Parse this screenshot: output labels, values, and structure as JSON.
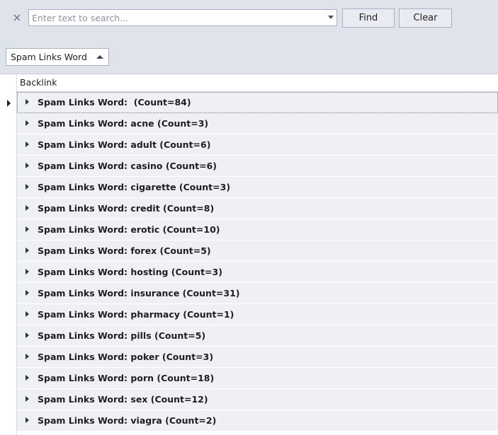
{
  "search": {
    "clear_icon": "×",
    "placeholder": "Enter text to search...",
    "value": "",
    "find_label": "Find",
    "clear_label": "Clear"
  },
  "group_panel": {
    "group_column": "Spam Links Word",
    "sort": "ascending"
  },
  "grid": {
    "column_header": "Backlink",
    "focused_row": 0,
    "group_rows": [
      "Spam Links Word:  (Count=84)",
      "Spam Links Word: acne (Count=3)",
      "Spam Links Word: adult (Count=6)",
      "Spam Links Word: casino (Count=6)",
      "Spam Links Word: cigarette (Count=3)",
      "Spam Links Word: credit (Count=8)",
      "Spam Links Word: erotic (Count=10)",
      "Spam Links Word: forex (Count=5)",
      "Spam Links Word: hosting (Count=3)",
      "Spam Links Word: insurance (Count=31)",
      "Spam Links Word: pharmacy (Count=1)",
      "Spam Links Word: pills (Count=5)",
      "Spam Links Word: poker (Count=3)",
      "Spam Links Word: porn (Count=18)",
      "Spam Links Word: sex (Count=12)",
      "Spam Links Word: viagra (Count=2)"
    ]
  },
  "icons": {
    "clear": "close-icon",
    "dropdown": "chevron-down-icon",
    "sort": "sort-ascending-icon",
    "expand": "expand-arrow-icon",
    "row_indicator": "row-indicator-icon"
  },
  "colors": {
    "panel_background": "#dfe3ec",
    "group_row_background": "#eef0f4",
    "button_background": "#e8ebf1",
    "border": "#a9b0be"
  }
}
